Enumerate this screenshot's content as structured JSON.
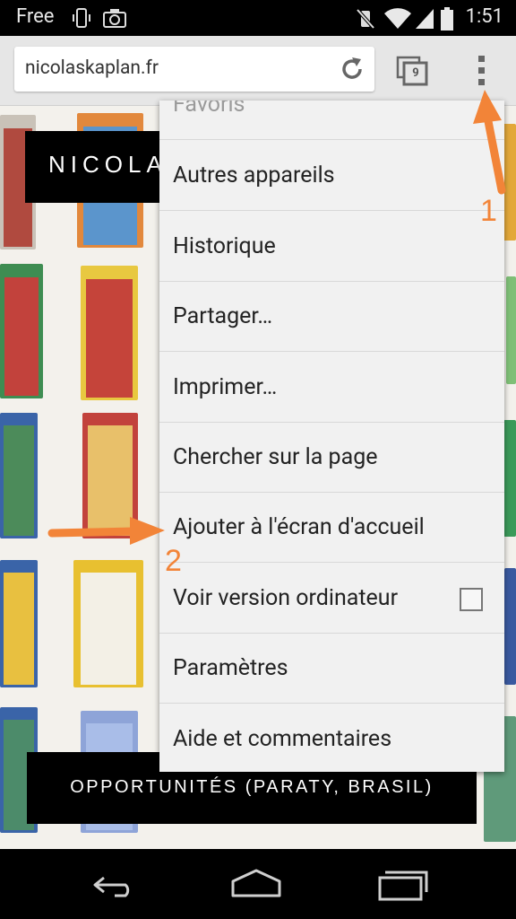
{
  "status_bar": {
    "carrier": "Free",
    "time": "1:51",
    "icons": [
      "phone-vibrate-icon",
      "camera-icon",
      "mute-icon",
      "wifi-icon",
      "signal-icon",
      "battery-icon"
    ]
  },
  "browser": {
    "url": "nicolaskaplan.fr",
    "tab_count": "9",
    "icons": [
      "reload-icon",
      "tabs-icon",
      "overflow-menu-icon"
    ]
  },
  "page": {
    "site_title": "NICOLA",
    "banner": "OPPORTUNITÉS (PARATY, BRASIL)"
  },
  "menu": {
    "items": [
      {
        "label": "Favoris"
      },
      {
        "label": "Autres appareils"
      },
      {
        "label": "Historique"
      },
      {
        "label": "Partager…"
      },
      {
        "label": "Imprimer…"
      },
      {
        "label": "Chercher sur la page"
      },
      {
        "label": "Ajouter à l'écran d'accueil"
      },
      {
        "label": "Voir version ordinateur",
        "checkbox": false
      },
      {
        "label": "Paramètres"
      },
      {
        "label": "Aide et commentaires"
      }
    ]
  },
  "annotations": {
    "step1": "1",
    "step2": "2",
    "color": "#f28438"
  },
  "nav_bar": {
    "icons": [
      "back-icon",
      "home-icon",
      "recents-icon"
    ]
  }
}
